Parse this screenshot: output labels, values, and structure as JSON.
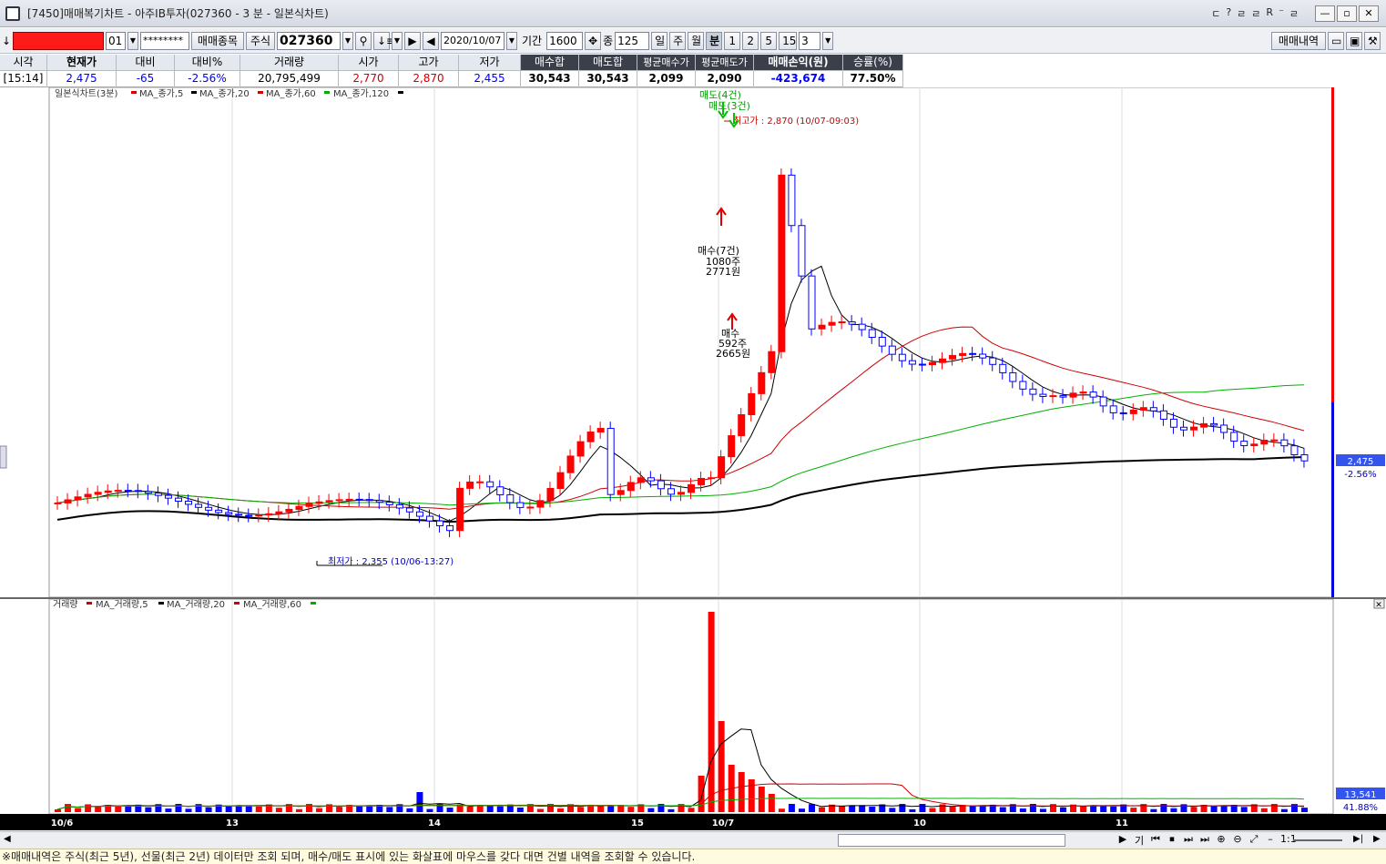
{
  "window": {
    "title": "[7450]매매복기차트 - 아주IB투자(027360 - 3 분 - 일본식차트)",
    "title_icons": [
      "ㄷ",
      "?",
      "ㄹ",
      "ㄹ",
      "R",
      "⁻",
      "ㄹ"
    ],
    "buttons": [
      "—",
      "▫",
      "✕"
    ]
  },
  "toolbar": {
    "arrow_label": "↓",
    "account_suffix": "01",
    "password_mask": "********",
    "trade_items_btn": "매매종목",
    "market_select": "주식",
    "code_value": "027360",
    "date_value": "2020/10/07",
    "period_label": "기간",
    "period_value": "1600",
    "count_label": "종",
    "count_value": "125",
    "tabs": [
      "일",
      "주",
      "월",
      "분",
      "1",
      "2",
      "5",
      "15"
    ],
    "active_tab": "분",
    "minute_value": "3",
    "trade_history_btn": "매매내역"
  },
  "quote": {
    "headers": [
      "시각",
      "현재가",
      "대비",
      "대비%",
      "거래량",
      "시가",
      "고가",
      "저가",
      "매수합",
      "매도합",
      "평균매수가",
      "평균매도가",
      "매매손익(원)",
      "승률(%)"
    ],
    "values": [
      "[15:14]",
      "2,475",
      "-65",
      "-2.56%",
      "20,795,499",
      "2,770",
      "2,870",
      "2,455",
      "30,543",
      "30,543",
      "2,099",
      "2,090",
      "-423,674",
      "77.50%"
    ]
  },
  "price_panel": {
    "legend_title": "일본식차트(3분)",
    "legend_items": [
      "MA_종가,5",
      "MA_종가,20",
      "MA_종가,60",
      "MA_종가,120"
    ],
    "legend_colors": [
      "#d00000",
      "#000000",
      "#d00000",
      "#00b000"
    ],
    "high_label": "최고가 : 2,870 (10/07-09:03)",
    "low_label": "최저가 : 2,355 (10/06-13:27)",
    "sell_marker": "매도(4건)",
    "sell_marker2": "매도(3건)",
    "buy_marker1_lines": [
      "매수(7건)",
      "1080주",
      "2771원"
    ],
    "buy_marker2_lines": [
      "매수",
      "592주",
      "2665원"
    ],
    "current_price_tag": "2,475",
    "current_change_tag": "-2.56%"
  },
  "volume_panel": {
    "legend_title": "거래량",
    "legend_items": [
      "MA_거래량,5",
      "MA_거래량,20",
      "MA_거래량,60"
    ],
    "legend_colors": [
      "#d00000",
      "#000000",
      "#00b000"
    ],
    "volume_tag": "13,541",
    "volume_pct_tag": "41.88%"
  },
  "xaxis": {
    "labels": [
      "10/6",
      "13",
      "14",
      "15",
      "10/7",
      "10",
      "11"
    ]
  },
  "scroll": {
    "nav": [
      "기",
      "⏮",
      "⏹",
      "⏭",
      "⏭",
      "⊕",
      "⊖",
      "⤢",
      "–",
      "1:1"
    ]
  },
  "footer": {
    "notice": "※매매내역은 주식(최근 5년), 선물(최근 2년) 데이터만 조회 되며, 매수/매도 표시에 있는 화살표에 마우스를 갖다 대면 건별 내역을 조회할 수 있습니다."
  },
  "colors": {
    "up": "#ff0000",
    "down": "#0000ff",
    "ma5": "#d00000",
    "ma20": "#000000",
    "ma120": "#00b000",
    "ma60": "#000000"
  }
}
